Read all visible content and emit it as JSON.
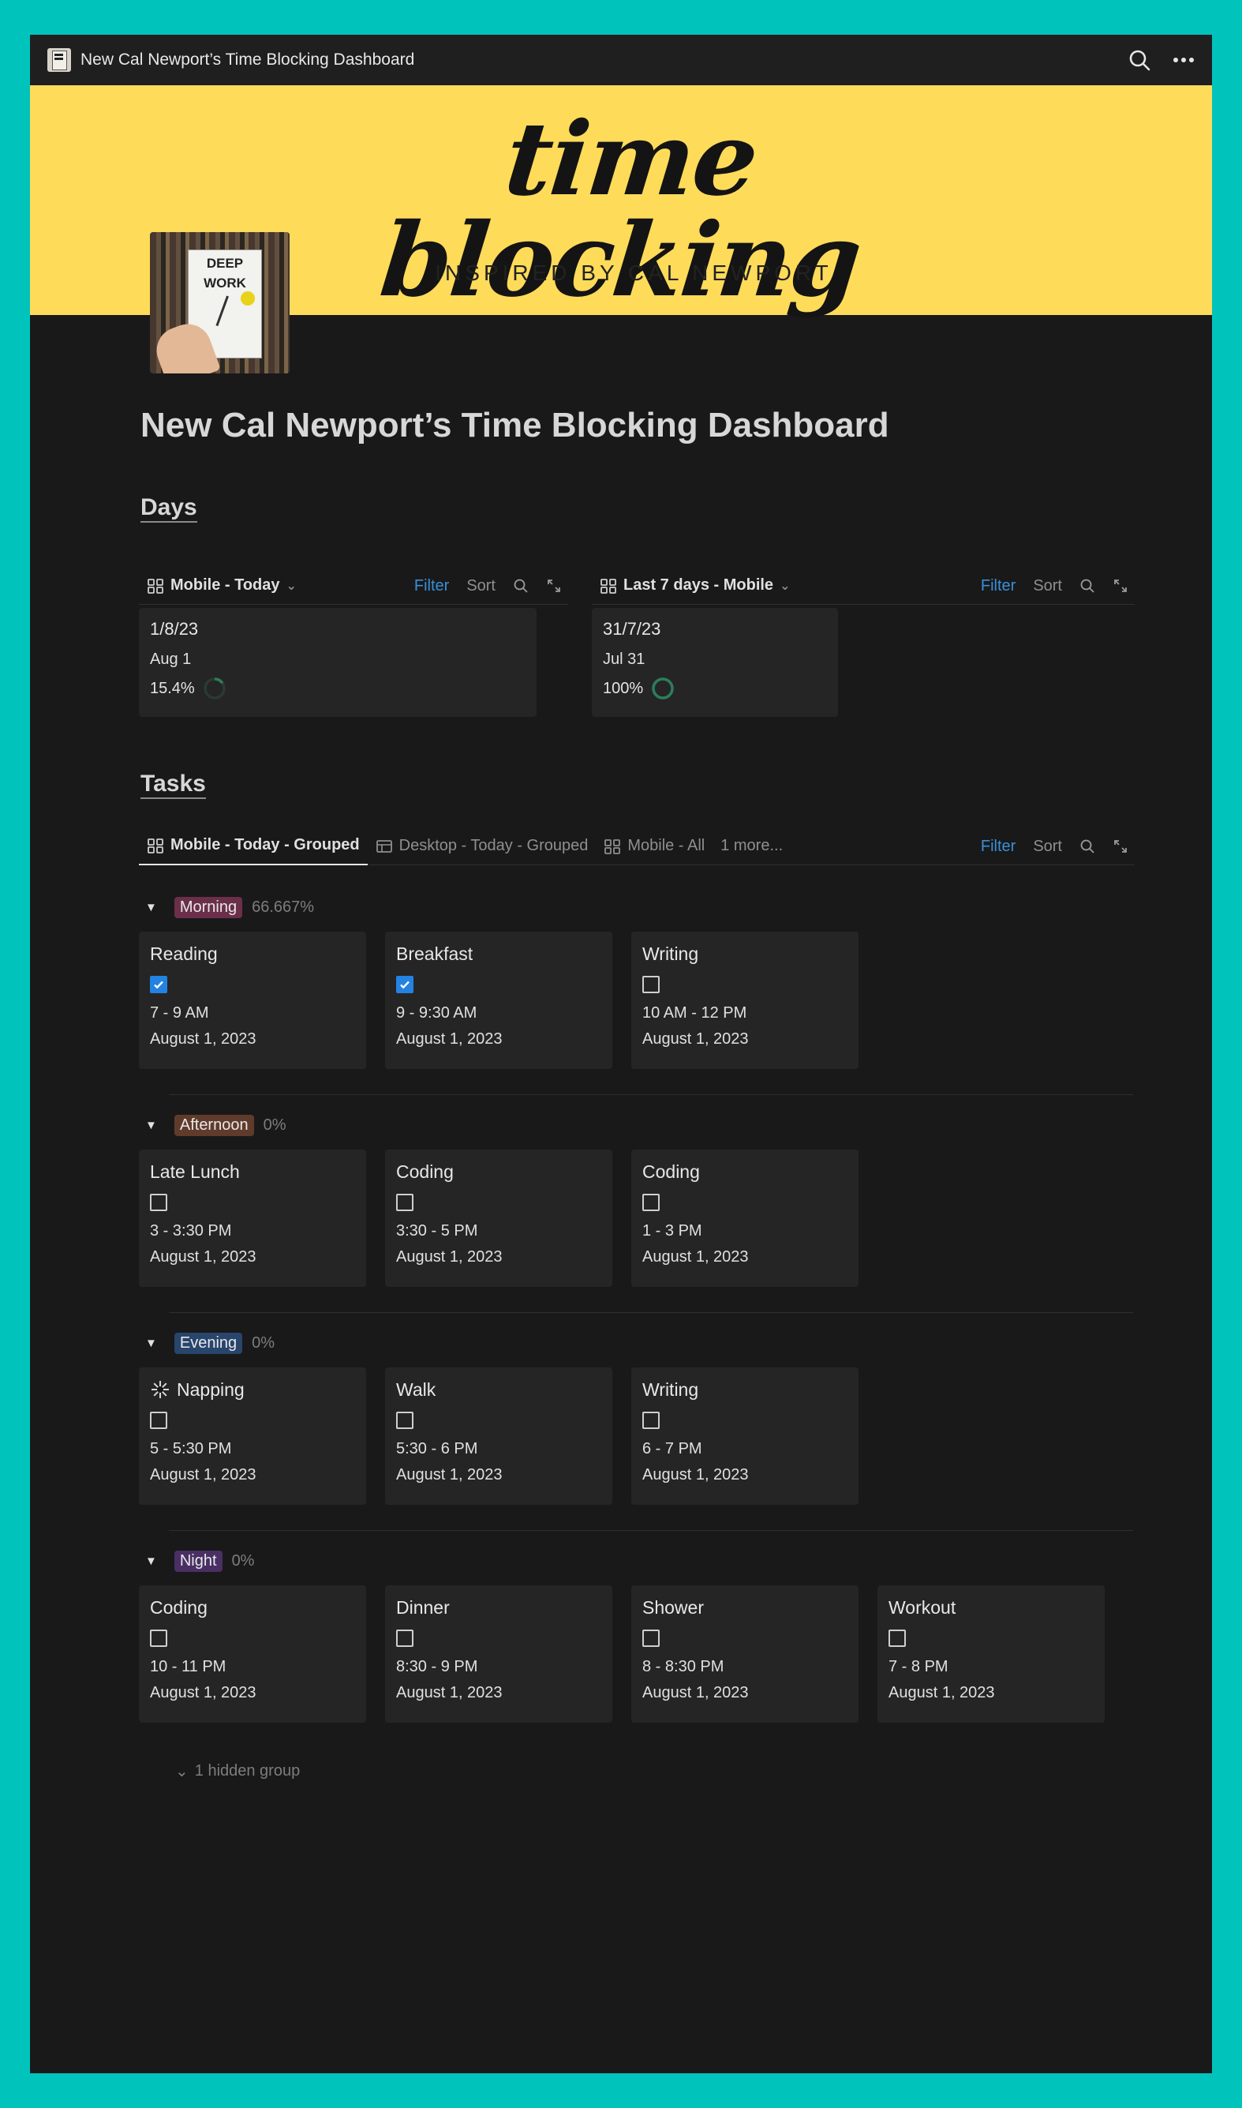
{
  "window": {
    "title": "New Cal Newport’s Time Blocking Dashboard"
  },
  "banner": {
    "script_text": "time blocking",
    "subtitle": "INSPIRED BY CAL NEWPORT"
  },
  "cover": {
    "book_title_line1": "DEEP",
    "book_title_line2": "WORK"
  },
  "page": {
    "title": "New Cal Newport’s Time Blocking Dashboard"
  },
  "days": {
    "heading": "Days",
    "left_view": {
      "label": "Mobile - Today",
      "filter": "Filter",
      "sort": "Sort",
      "card": {
        "title": "1/8/23",
        "date": "Aug 1",
        "percent": "15.4%",
        "progress": 0.154
      }
    },
    "right_view": {
      "label": "Last 7 days - Mobile",
      "filter": "Filter",
      "sort": "Sort",
      "card": {
        "title": "31/7/23",
        "date": "Jul 31",
        "percent": "100%",
        "progress": 1.0
      }
    }
  },
  "tasks": {
    "heading": "Tasks",
    "tabs": [
      {
        "label": "Mobile - Today - Grouped"
      },
      {
        "label": "Desktop - Today - Grouped"
      },
      {
        "label": "Mobile - All"
      },
      {
        "label": "1 more..."
      }
    ],
    "filter": "Filter",
    "sort": "Sort",
    "groups": [
      {
        "name": "Morning",
        "percent": "66.667%",
        "color": "#6b2f4a",
        "cards": [
          {
            "title": "Reading",
            "checked": true,
            "time": "7 - 9 AM",
            "date": "August 1, 2023"
          },
          {
            "title": "Breakfast",
            "checked": true,
            "time": "9 - 9:30 AM",
            "date": "August 1, 2023"
          },
          {
            "title": "Writing",
            "checked": false,
            "time": "10 AM - 12 PM",
            "date": "August 1, 2023"
          }
        ]
      },
      {
        "name": "Afternoon",
        "percent": "0%",
        "color": "#603b2c",
        "cards": [
          {
            "title": "Late Lunch",
            "checked": false,
            "time": "3 - 3:30 PM",
            "date": "August 1, 2023"
          },
          {
            "title": "Coding",
            "checked": false,
            "time": "3:30 - 5 PM",
            "date": "August 1, 2023"
          },
          {
            "title": "Coding",
            "checked": false,
            "time": "1 - 3 PM",
            "date": "August 1, 2023"
          }
        ]
      },
      {
        "name": "Evening",
        "percent": "0%",
        "color": "#28456c",
        "cards": [
          {
            "title": "Napping",
            "checked": false,
            "time": "5 - 5:30 PM",
            "date": "August 1, 2023",
            "icon": "sparkle-icon"
          },
          {
            "title": "Walk",
            "checked": false,
            "time": "5:30 - 6 PM",
            "date": "August 1, 2023"
          },
          {
            "title": "Writing",
            "checked": false,
            "time": "6 - 7 PM",
            "date": "August 1, 2023"
          }
        ]
      },
      {
        "name": "Night",
        "percent": "0%",
        "color": "#492f64",
        "cards": [
          {
            "title": "Coding",
            "checked": false,
            "time": "10 - 11 PM",
            "date": "August 1, 2023"
          },
          {
            "title": "Dinner",
            "checked": false,
            "time": "8:30 - 9 PM",
            "date": "August 1, 2023"
          },
          {
            "title": "Shower",
            "checked": false,
            "time": "8 - 8:30 PM",
            "date": "August 1, 2023"
          },
          {
            "title": "Workout",
            "checked": false,
            "time": "7 - 8 PM",
            "date": "August 1, 2023"
          }
        ]
      }
    ],
    "hidden_groups": "1 hidden group"
  },
  "colors": {
    "accent_blue": "#2383e2",
    "filter_blue": "#3a8fd9",
    "progress_green": "#2e7d5b",
    "banner_yellow": "#ffdb5a",
    "frame_teal": "#00c4bc"
  }
}
